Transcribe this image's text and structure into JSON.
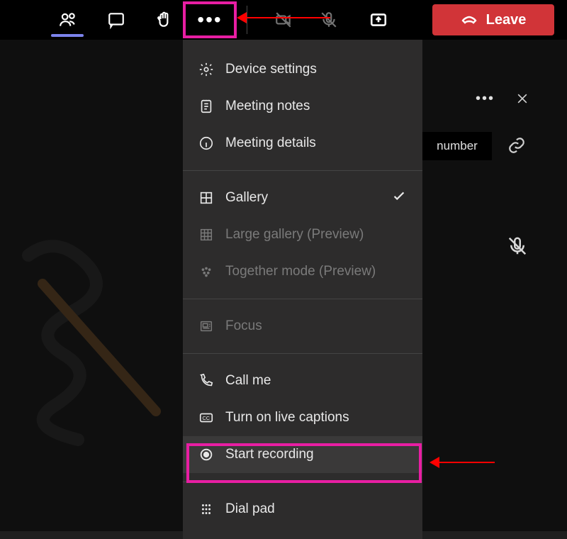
{
  "toolbar": {
    "leave_label": "Leave"
  },
  "menu": {
    "device_settings": "Device settings",
    "meeting_notes": "Meeting notes",
    "meeting_details": "Meeting details",
    "gallery": "Gallery",
    "large_gallery": "Large gallery (Preview)",
    "together_mode": "Together mode (Preview)",
    "focus": "Focus",
    "call_me": "Call me",
    "live_captions": "Turn on live captions",
    "start_recording": "Start recording",
    "dial_pad": "Dial pad"
  },
  "panel": {
    "number_tab": "number"
  }
}
